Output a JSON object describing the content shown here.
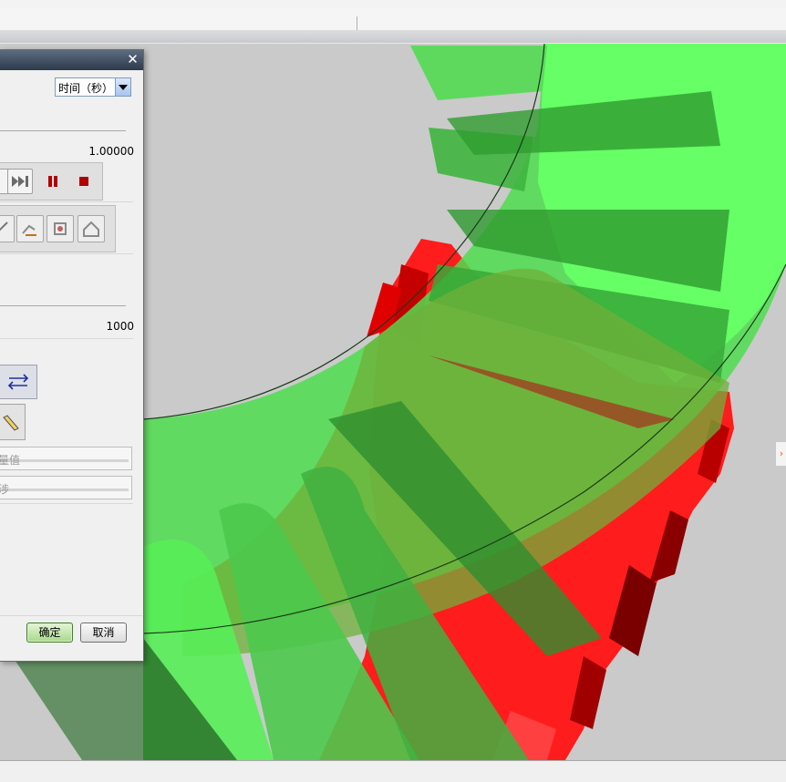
{
  "dialog": {
    "close_icon": "close-icon",
    "time_unit_select": "时间（秒）",
    "end_time_value": "1.00000",
    "steps_value": "1000",
    "field1_placeholder": "量值",
    "field2_placeholder": "涉",
    "ok_label": "确定",
    "cancel_label": "取消"
  },
  "playback": {
    "icons": [
      "step-back-icon",
      "fast-forward-icon",
      "pause-icon",
      "stop-icon"
    ],
    "colors": {
      "pause": "#b00000",
      "stop": "#b00000"
    }
  },
  "viewport": {
    "background": "#cacaca",
    "gear_green": "#5cff5c",
    "gear_red": "#ff1a1a"
  },
  "side_handle_icon": "collapse-handle-icon"
}
